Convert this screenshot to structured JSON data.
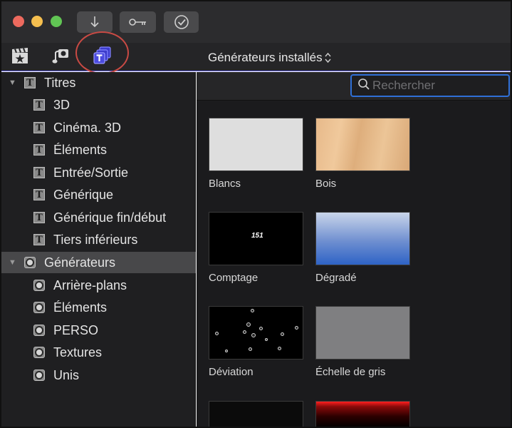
{
  "toolbar": {
    "buttons": [
      {
        "name": "import",
        "icon": "download-arrow-icon"
      },
      {
        "name": "keywords",
        "icon": "key-icon"
      },
      {
        "name": "background-tasks",
        "icon": "checkmark-circle-icon"
      }
    ]
  },
  "browser": {
    "categories": [
      {
        "name": "photos-and-audio",
        "icon": "clapperboard-star-icon"
      },
      {
        "name": "music",
        "icon": "music-camera-icon"
      },
      {
        "name": "titles-and-generators",
        "icon": "titles-generators-icon",
        "active": true
      }
    ],
    "generator_selector": "Générateurs installés",
    "accent_color": "#5a5adf",
    "highlight_color": "#c94a44"
  },
  "search": {
    "placeholder": "Rechercher",
    "value": ""
  },
  "sidebar": {
    "titles_group": {
      "label": "Titres",
      "items": [
        {
          "label": "3D"
        },
        {
          "label": "Cinéma. 3D"
        },
        {
          "label": "Éléments"
        },
        {
          "label": "Entrée/Sortie"
        },
        {
          "label": "Générique"
        },
        {
          "label": "Générique fin/début"
        },
        {
          "label": "Tiers inférieurs"
        }
      ]
    },
    "generators_group": {
      "label": "Générateurs",
      "selected": true,
      "items": [
        {
          "label": "Arrière-plans"
        },
        {
          "label": "Éléments"
        },
        {
          "label": "PERSO"
        },
        {
          "label": "Textures"
        },
        {
          "label": "Unis"
        }
      ]
    }
  },
  "generators": [
    {
      "label": "Blancs"
    },
    {
      "label": "Bois"
    },
    {
      "label": "Comptage",
      "thumb_text": "151"
    },
    {
      "label": "Dégradé"
    },
    {
      "label": "Déviation"
    },
    {
      "label": "Échelle de gris"
    }
  ]
}
